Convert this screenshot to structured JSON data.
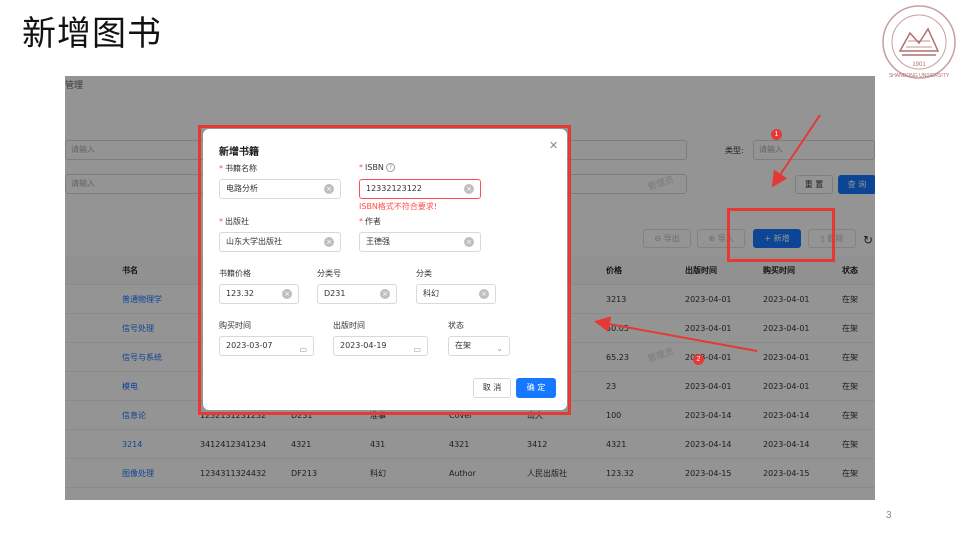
{
  "slide": {
    "title": "新增图书",
    "page_number": "3",
    "logo_year": "1901",
    "logo_text": "SHANDONG UNIVERSITY"
  },
  "app": {
    "breadcrumb": "管理",
    "filters": {
      "row1_placeholder": "请输入",
      "row2_placeholder": "请输入",
      "type_label": "类型:",
      "type_placeholder": "请输入",
      "reset_label": "重 置",
      "query_label": "查 询"
    },
    "toolbar": {
      "export_label": "导出",
      "import_label": "导入",
      "add_label": "+ 新增",
      "delete_label": "删除"
    },
    "table": {
      "columns": [
        "书名",
        "",
        "",
        "",
        "",
        "",
        "价格",
        "出版时间",
        "购买时间",
        "状态"
      ],
      "rows": [
        [
          "普通物理学",
          "",
          "",
          "",
          "",
          "",
          "3213",
          "2023-04-01",
          "2023-04-01",
          "在架"
        ],
        [
          "信号处理",
          "",
          "",
          "",
          "",
          "",
          "50.05",
          "2023-04-01",
          "2023-04-01",
          "在架"
        ],
        [
          "信号与系统",
          "",
          "",
          "",
          "",
          "",
          "65.23",
          "2023-04-01",
          "2023-04-01",
          "在架"
        ],
        [
          "模电",
          "",
          "",
          "",
          "",
          "",
          "23",
          "2023-04-01",
          "2023-04-01",
          "在架"
        ],
        [
          "信息论",
          "1232131231232",
          "D231",
          "准事",
          "Cover",
          "山大",
          "100",
          "2023-04-14",
          "2023-04-14",
          "在架"
        ],
        [
          "3214",
          "3412412341234",
          "4321",
          "431",
          "4321",
          "3412",
          "4321",
          "2023-04-14",
          "2023-04-14",
          "在架"
        ],
        [
          "图像处理",
          "1234311324432",
          "DF213",
          "科幻",
          "Author",
          "人民出版社",
          "123.32",
          "2023-04-15",
          "2023-04-15",
          "在架"
        ]
      ]
    },
    "watermark": "管理员"
  },
  "dialog": {
    "title": "新增书籍",
    "fields": {
      "name": {
        "label": "书籍名称",
        "value": "电路分析"
      },
      "isbn": {
        "label": "ISBN",
        "value": "12332123122",
        "error": "ISBN格式不符合要求!"
      },
      "publisher": {
        "label": "出版社",
        "value": "山东大学出版社"
      },
      "author": {
        "label": "作者",
        "value": "王德强"
      },
      "price": {
        "label": "书籍价格",
        "value": "123.32"
      },
      "class_no": {
        "label": "分类号",
        "value": "D231"
      },
      "category": {
        "label": "分类",
        "value": "科幻"
      },
      "buy_date": {
        "label": "购买时间",
        "value": "2023-03-07"
      },
      "pub_date": {
        "label": "出版时间",
        "value": "2023-04-19"
      },
      "status": {
        "label": "状态",
        "value": "在架"
      }
    },
    "cancel_label": "取 消",
    "ok_label": "确 定"
  },
  "annotations": {
    "badge1": "1",
    "badge2": "2",
    "color": "#e53935"
  }
}
